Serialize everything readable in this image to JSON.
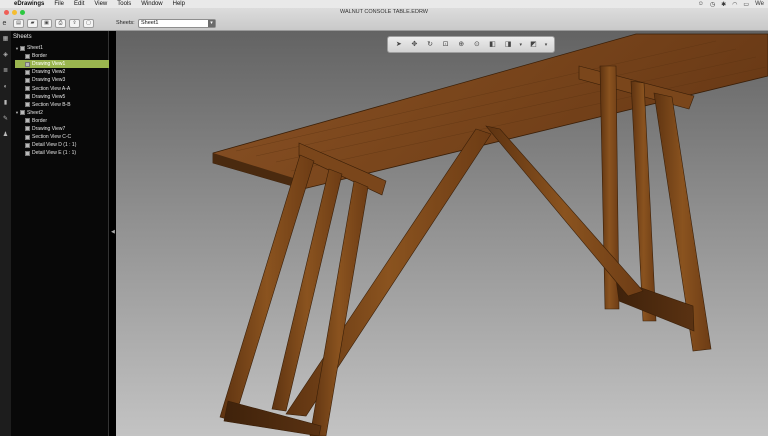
{
  "menubar": {
    "app_name": "eDrawings",
    "items": [
      "File",
      "Edit",
      "View",
      "Tools",
      "Window",
      "Help"
    ],
    "locale": "We"
  },
  "window": {
    "title": "WALNUT CONSOLE TABLE.EDRW"
  },
  "toolbar": {
    "sheets_label": "Sheets:",
    "sheet_value": "Sheet1"
  },
  "panel": {
    "title": "Sheets",
    "tree": [
      {
        "label": "Sheet1",
        "level": 0
      },
      {
        "label": "Border",
        "level": 1
      },
      {
        "label": "Drawing View1",
        "level": 1,
        "selected": true
      },
      {
        "label": "Drawing View2",
        "level": 1
      },
      {
        "label": "Drawing View3",
        "level": 1
      },
      {
        "label": "Section View A-A",
        "level": 1
      },
      {
        "label": "Drawing View5",
        "level": 1
      },
      {
        "label": "Section View B-B",
        "level": 1
      },
      {
        "label": "Sheet2",
        "level": 0
      },
      {
        "label": "Border",
        "level": 1
      },
      {
        "label": "Drawing View7",
        "level": 1
      },
      {
        "label": "Section View C-C",
        "level": 1
      },
      {
        "label": "Detail View D (1 : 1)",
        "level": 1
      },
      {
        "label": "Detail View E (1 : 1)",
        "level": 1
      }
    ]
  },
  "colors": {
    "selection": "#9ab54f",
    "wood": "#6b3c16"
  }
}
